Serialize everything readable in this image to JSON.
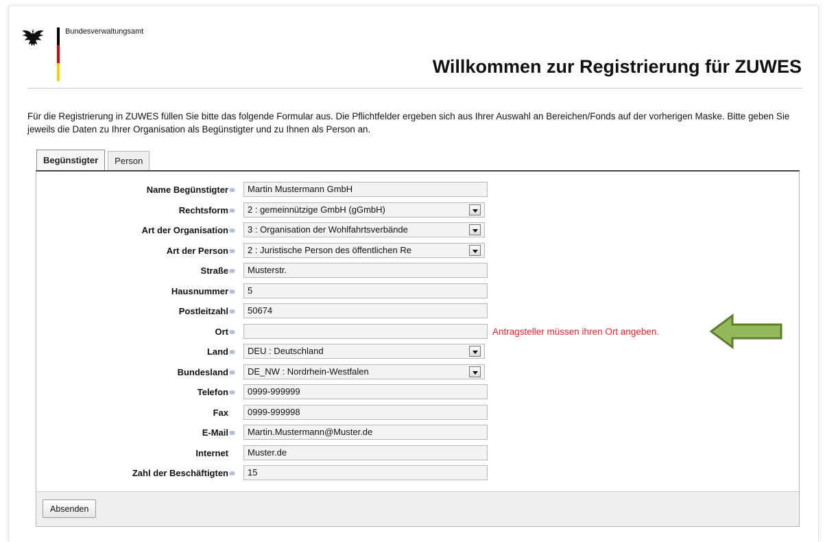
{
  "header": {
    "agency": "Bundesverwaltungsamt",
    "title": "Willkommen zur Registrierung für ZUWES",
    "flag_colors": [
      "#000000",
      "#dd0000",
      "#ffcc00"
    ]
  },
  "intro": "Für die Registrierung in ZUWES füllen Sie bitte das folgende Formular aus. Die Pflichtfelder ergeben sich aus Ihrer Auswahl an Bereichen/Fonds auf der vorherigen Maske. Bitte geben Sie jeweils die Daten zu Ihrer Organisation als Begünstigter und zu Ihnen als Person an.",
  "tabs": [
    {
      "label": "Begünstigter",
      "active": true
    },
    {
      "label": "Person",
      "active": false
    }
  ],
  "form": {
    "fields": [
      {
        "label": "Name Begünstigter",
        "value": "Martin Mustermann GmbH",
        "required": true,
        "type": "text"
      },
      {
        "label": "Rechtsform",
        "value": "2 : gemeinnützige GmbH (gGmbH)",
        "required": true,
        "type": "select"
      },
      {
        "label": "Art der Organisation",
        "value": "3 : Organisation der Wohlfahrtsverbände",
        "required": true,
        "type": "select"
      },
      {
        "label": "Art der Person",
        "value": "2 : Juristische Person des öffentlichen Re",
        "required": true,
        "type": "select"
      },
      {
        "label": "Straße",
        "value": "Musterstr.",
        "required": true,
        "type": "text"
      },
      {
        "label": "Hausnummer",
        "value": "5",
        "required": true,
        "type": "text"
      },
      {
        "label": "Postleitzahl",
        "value": "50674",
        "required": true,
        "type": "text"
      },
      {
        "label": "Ort",
        "value": "",
        "required": true,
        "type": "text",
        "error": "Antragsteller müssen ihren Ort angeben."
      },
      {
        "label": "Land",
        "value": "DEU : Deutschland",
        "required": true,
        "type": "select"
      },
      {
        "label": "Bundesland",
        "value": "DE_NW : Nordrhein-Westfalen",
        "required": true,
        "type": "select"
      },
      {
        "label": "Telefon",
        "value": "0999-999999",
        "required": true,
        "type": "text"
      },
      {
        "label": "Fax",
        "value": "0999-999998",
        "required": false,
        "type": "text"
      },
      {
        "label": "E-Mail",
        "value": "Martin.Mustermann@Muster.de",
        "required": true,
        "type": "text"
      },
      {
        "label": "Internet",
        "value": "Muster.de",
        "required": false,
        "type": "text"
      },
      {
        "label": "Zahl der Beschäftigten",
        "value": "15",
        "required": true,
        "type": "text"
      }
    ],
    "submit_label": "Absenden"
  },
  "colors": {
    "error": "#e8202a",
    "arrow_fill": "#93b95a",
    "arrow_stroke": "#5e7d2c",
    "required_marker": "#a9bcdc"
  },
  "icons": [
    "eagle-icon",
    "required-marker-icon",
    "dropdown-arrow-icon",
    "arrow-left-icon"
  ]
}
